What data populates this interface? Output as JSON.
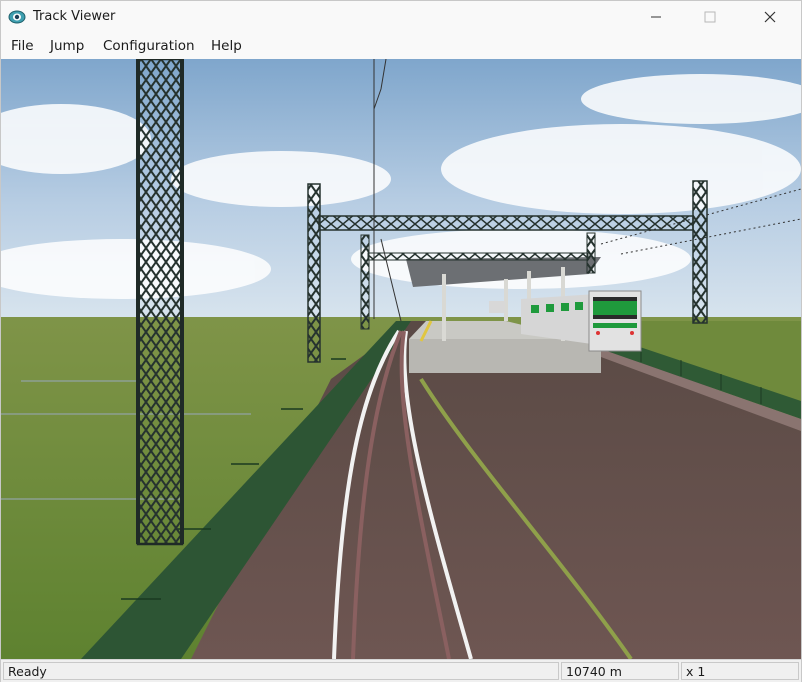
{
  "window": {
    "title": "Track Viewer",
    "app_icon": "eye-icon"
  },
  "menu": {
    "items": [
      "File",
      "Jump",
      "Configuration",
      "Help"
    ]
  },
  "viewport": {
    "scene": "3d-railway-view"
  },
  "status": {
    "state": "Ready",
    "distance": "10740 m",
    "speed": "x 1"
  },
  "colors": {
    "sky": "#8fb6d8",
    "grass": "#6d8a3a",
    "fence": "#2f5a35",
    "mast": "#2c3b36",
    "train_stripe": "#1f9a3c"
  }
}
